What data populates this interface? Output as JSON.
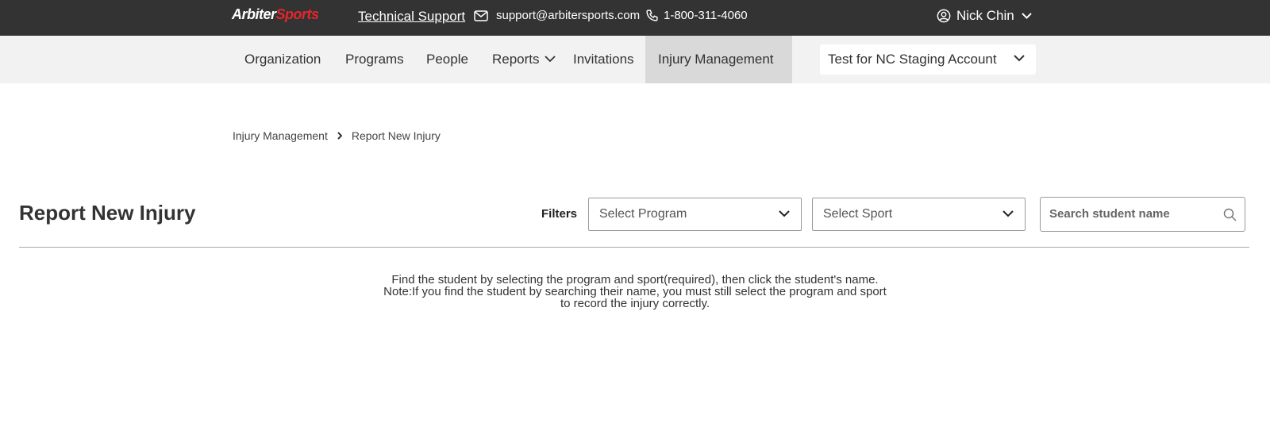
{
  "header": {
    "logo": {
      "part1": "Arbiter",
      "part2": "Sports"
    },
    "tech_support": "Technical Support",
    "email": "support@arbitersports.com",
    "phone": "1-800-311-4060",
    "user_name": "Nick Chin"
  },
  "nav": {
    "items": [
      "Organization",
      "Programs",
      "People",
      "Reports",
      "Invitations",
      "Injury Management"
    ],
    "active": "Injury Management",
    "account": "Test for NC Staging Account"
  },
  "breadcrumb": {
    "parent": "Injury Management",
    "current": "Report New Injury"
  },
  "page": {
    "title": "Report New Injury",
    "filters_label": "Filters",
    "program_select": "Select Program",
    "sport_select": "Select Sport",
    "search_placeholder": "Search student name",
    "instructions": [
      "Find the student by selecting the program and sport(required), then click the student's name.",
      "Note:If you find the student by searching their name, you must still select the program and sport",
      "to record the injury correctly."
    ]
  },
  "colors": {
    "topbar": "#333333",
    "navbar": "#f2f2f2",
    "nav_active": "#d9d9d9",
    "logo_accent": "#e3262b"
  },
  "icons": [
    "mail-icon",
    "phone-icon",
    "user-circle-icon",
    "chevron-down-icon",
    "search-icon"
  ]
}
